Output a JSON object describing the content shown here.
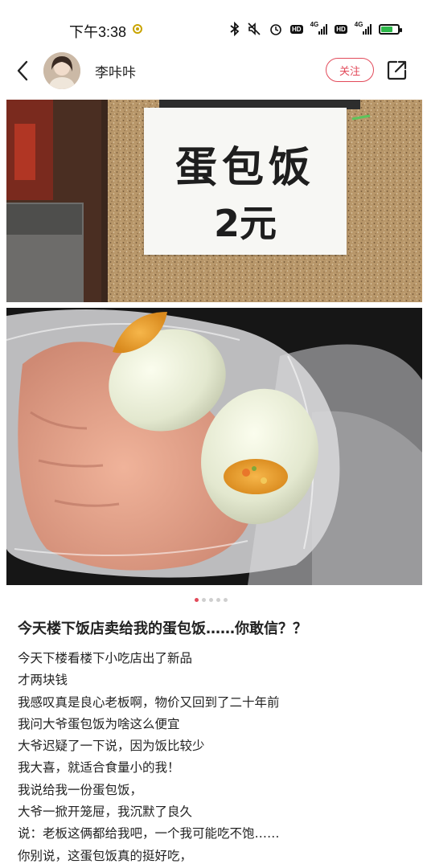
{
  "status_bar": {
    "time": "下午3:38",
    "net_label_1": "4G",
    "net_label_2": "4G",
    "hd_label_1": "HD",
    "hd_label_2": "HD"
  },
  "header": {
    "username": "李咔咔",
    "follow_label": "关注"
  },
  "images": {
    "sign_line_1": "蛋包饭",
    "sign_line_2": "2元"
  },
  "carousel": {
    "total": 5,
    "active_index": 0
  },
  "post": {
    "title": "今天楼下饭店卖给我的蛋包饭……你敢信？？",
    "lines": [
      "今天下楼看楼下小吃店出了新品",
      "才两块钱",
      "我感叹真是良心老板啊，物价又回到了二十年前",
      "我问大爷蛋包饭为啥这么便宜",
      "大爷迟疑了一下说，因为饭比较少",
      "我大喜，就适合食量小的我！",
      "我说给我一份蛋包饭，",
      "大爷一掀开笼屉，我沉默了良久",
      "说：老板这俩都给我吧，一个我可能吃不饱……",
      "你别说，这蛋包饭真的挺好吃，"
    ]
  },
  "colors": {
    "accent": "#e24a5a",
    "battery": "#2db84a",
    "text": "#222222"
  },
  "icons": [
    "bluetooth-icon",
    "mute-icon",
    "alarm-icon",
    "battery-icon",
    "back-icon",
    "share-icon"
  ]
}
